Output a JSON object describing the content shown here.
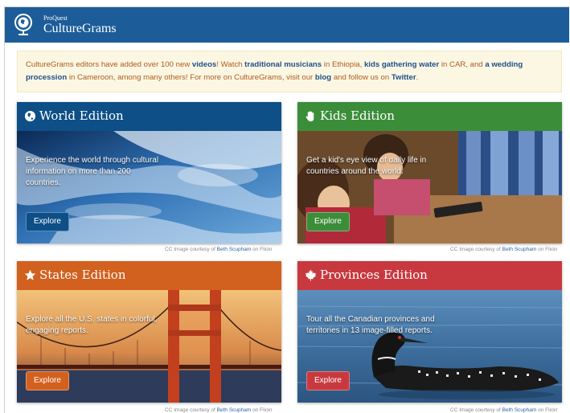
{
  "header": {
    "brand_small": "ProQuest",
    "brand_big": "CultureGrams",
    "logo_icon": "globe-icon",
    "bar_color": "#1c5d99"
  },
  "announcement": {
    "t1": "CultureGrams editors have added over 100 new ",
    "videos": "videos",
    "t2": "! Watch ",
    "musicians": "traditional musicians",
    "t3": " in Ethiopia, ",
    "kids_water": "kids gathering water",
    "t4": " in CAR, and ",
    "wedding": "a wedding procession",
    "t5": " in Cameroon, among many others! For more on CultureGrams, visit our ",
    "blog": "blog",
    "t6": " and follow us on ",
    "twitter": "Twitter",
    "t7": ".",
    "bg_color": "#fbf7e2"
  },
  "editions": {
    "world": {
      "title": "World Edition",
      "icon": "globe-icon",
      "description": "Experience the world through cultural information on more than 200 countries.",
      "button": "Explore",
      "color": "#0d4f86"
    },
    "kids": {
      "title": "Kids Edition",
      "icon": "hand-icon",
      "description": "Get a kid's eye view of daily life in countries around the world.",
      "button": "Explore",
      "color": "#3c8d3a"
    },
    "states": {
      "title": "States Edition",
      "icon": "star-icon",
      "description": "Explore all the U.S. states in colorful, engaging reports.",
      "button": "Explore",
      "color": "#d2601e"
    },
    "provinces": {
      "title": "Provinces Edition",
      "icon": "maple-leaf-icon",
      "description": "Tour all the Canadian provinces and territories in 13 image-filled reports.",
      "button": "Explore",
      "color": "#c8393f"
    }
  },
  "credit": {
    "prefix": "CC Image courtesy of ",
    "author": "Beth Scupham",
    "suffix": " on Flickr"
  }
}
